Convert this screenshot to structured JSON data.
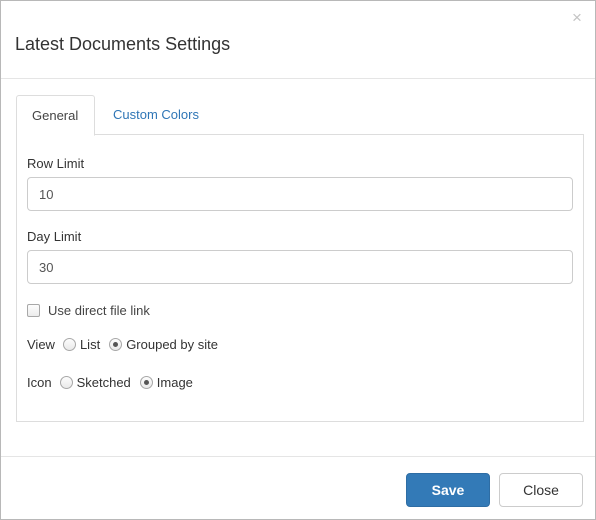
{
  "dialog": {
    "title": "Latest Documents Settings",
    "close_glyph": "×"
  },
  "tabs": [
    {
      "label": "General",
      "active": true
    },
    {
      "label": "Custom Colors",
      "active": false
    }
  ],
  "form": {
    "row_limit": {
      "label": "Row Limit",
      "value": "10"
    },
    "day_limit": {
      "label": "Day Limit",
      "value": "30"
    },
    "direct_link": {
      "label": "Use direct file link",
      "checked": false
    },
    "view": {
      "label": "View",
      "options": [
        {
          "label": "List",
          "checked": false
        },
        {
          "label": "Grouped by site",
          "checked": true
        }
      ]
    },
    "icon": {
      "label": "Icon",
      "options": [
        {
          "label": "Sketched",
          "checked": false
        },
        {
          "label": "Image",
          "checked": true
        }
      ]
    }
  },
  "footer": {
    "save_label": "Save",
    "close_label": "Close"
  },
  "colors": {
    "primary": "#337ab7",
    "tab_link": "#2f76b6"
  }
}
